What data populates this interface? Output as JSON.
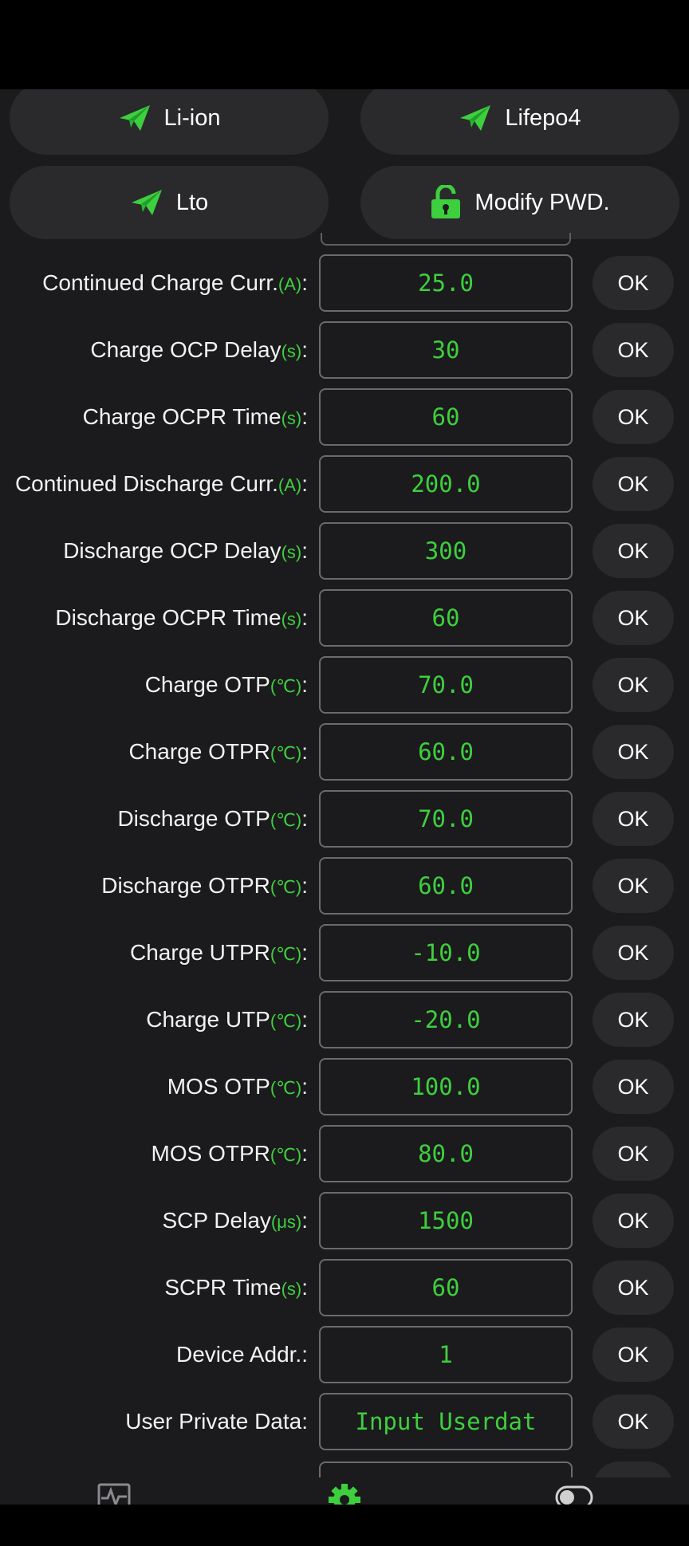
{
  "presets": {
    "li_ion": "Li-ion",
    "lifepo4": "Lifepo4",
    "lto": "Lto",
    "modify_pwd": "Modify PWD."
  },
  "ok_label": "OK",
  "rows": [
    {
      "name": "Continued Charge Curr.",
      "unit": "(A)",
      "value": "25.0"
    },
    {
      "name": "Charge OCP Delay",
      "unit": "(s)",
      "value": "30"
    },
    {
      "name": "Charge OCPR Time",
      "unit": "(s)",
      "value": "60"
    },
    {
      "name": "Continued Discharge Curr.",
      "unit": "(A)",
      "value": "200.0"
    },
    {
      "name": "Discharge OCP Delay",
      "unit": "(s)",
      "value": "300"
    },
    {
      "name": "Discharge OCPR Time",
      "unit": "(s)",
      "value": "60"
    },
    {
      "name": "Charge OTP",
      "unit": "(℃)",
      "value": "70.0"
    },
    {
      "name": "Charge OTPR",
      "unit": "(℃)",
      "value": "60.0"
    },
    {
      "name": "Discharge OTP",
      "unit": "(℃)",
      "value": "70.0"
    },
    {
      "name": "Discharge OTPR",
      "unit": "(℃)",
      "value": "60.0"
    },
    {
      "name": "Charge UTPR",
      "unit": "(℃)",
      "value": "-10.0"
    },
    {
      "name": "Charge UTP",
      "unit": "(℃)",
      "value": "-20.0"
    },
    {
      "name": "MOS OTP",
      "unit": "(℃)",
      "value": "100.0"
    },
    {
      "name": "MOS OTPR",
      "unit": "(℃)",
      "value": "80.0"
    },
    {
      "name": "SCP Delay",
      "unit": "(μs)",
      "value": "1500"
    },
    {
      "name": "SCPR Time",
      "unit": "(s)",
      "value": "60"
    },
    {
      "name": "Device Addr.",
      "unit": "",
      "value": "1"
    },
    {
      "name": "User Private Data",
      "unit": "",
      "value": "",
      "placeholder": "Input Userdat"
    }
  ],
  "colors": {
    "accent": "#3ecf3e",
    "background": "#1b1b1d",
    "button": "#2a2a2d",
    "text": "#f2f2f2"
  },
  "nav": {
    "items": [
      "monitor-icon",
      "settings-icon",
      "toggle-icon"
    ],
    "active": "settings-icon"
  }
}
